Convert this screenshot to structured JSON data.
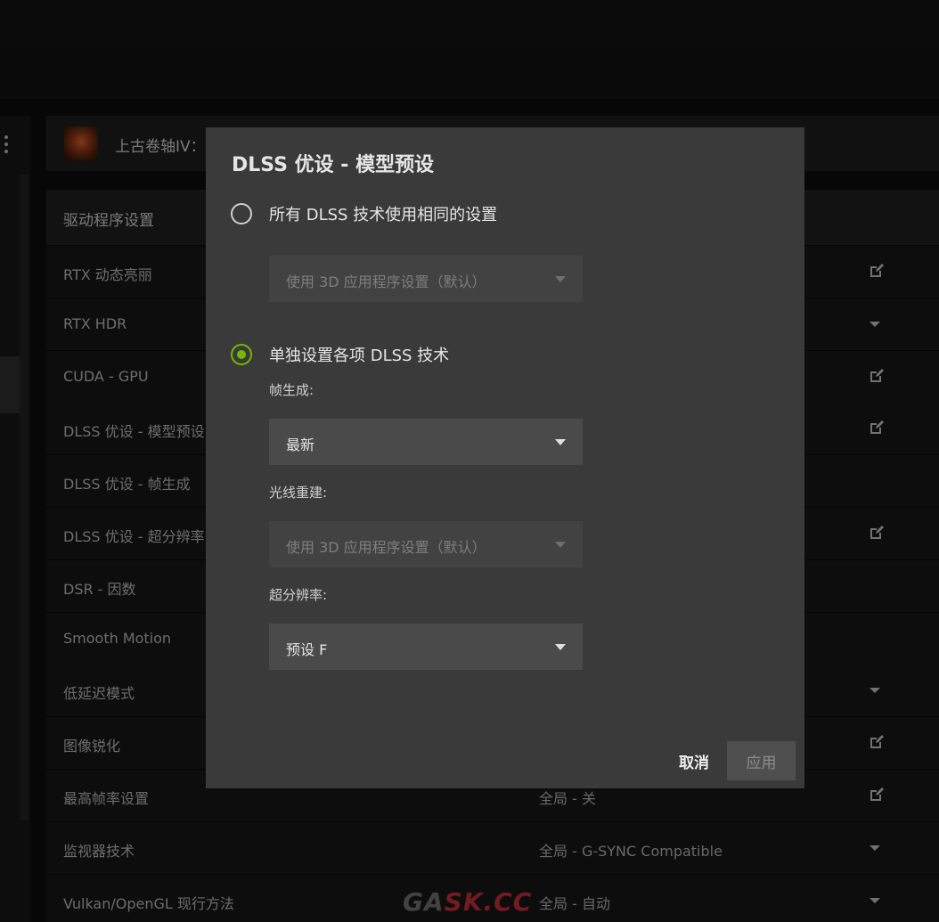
{
  "game": {
    "title": "上古卷轴IV："
  },
  "section": {
    "title": "驱动程序设置"
  },
  "rows": [
    {
      "label": "RTX 动态亮丽",
      "value": "",
      "icon": "edit-icon"
    },
    {
      "label": "RTX HDR",
      "value": "",
      "icon": "chevron-down-icon"
    },
    {
      "label": "CUDA - GPU",
      "value": "",
      "icon": "edit-icon"
    },
    {
      "label": "DLSS 优设 - 模型预设",
      "value": "",
      "icon": "edit-icon"
    },
    {
      "label": "DLSS 优设 - 帧生成",
      "value": "",
      "icon": ""
    },
    {
      "label": "DLSS 优设 - 超分辨率",
      "value": "",
      "icon": "edit-icon"
    },
    {
      "label": "DSR - 因数",
      "value": "",
      "icon": ""
    },
    {
      "label": "Smooth Motion",
      "value": "",
      "icon": ""
    },
    {
      "label": "低延迟模式",
      "value": "",
      "icon": "chevron-down-icon"
    },
    {
      "label": "图像锐化",
      "value": "",
      "icon": "edit-icon"
    },
    {
      "label": "最高帧率设置",
      "value": "全局 - 关",
      "icon": "edit-icon"
    },
    {
      "label": "监视器技术",
      "value": "全局 - G-SYNC Compatible",
      "icon": "chevron-down-icon"
    },
    {
      "label": "Vulkan/OpenGL 现行方法",
      "value": "全局 - 自动",
      "icon": "chevron-down-icon"
    }
  ],
  "dialog": {
    "title": "DLSS 优设 - 模型预设",
    "option_all": {
      "label": "所有 DLSS 技术使用相同的设置",
      "selected": false,
      "select_value": "使用 3D 应用程序设置（默认）"
    },
    "option_individual": {
      "label": "单独设置各项 DLSS 技术",
      "selected": true
    },
    "frame_gen": {
      "label": "帧生成:",
      "value": "最新"
    },
    "ray_reconstruction": {
      "label": "光线重建:",
      "value": "使用 3D 应用程序设置（默认）"
    },
    "super_resolution": {
      "label": "超分辨率:",
      "value": "预设 F"
    },
    "cancel_label": "取消",
    "apply_label": "应用"
  },
  "watermark": {
    "part1": "GA",
    "part2": "SK.CC"
  },
  "colors": {
    "accent": "#76b900",
    "modal_bg": "#3a3a3a",
    "page_bg": "#0b0b0b"
  }
}
